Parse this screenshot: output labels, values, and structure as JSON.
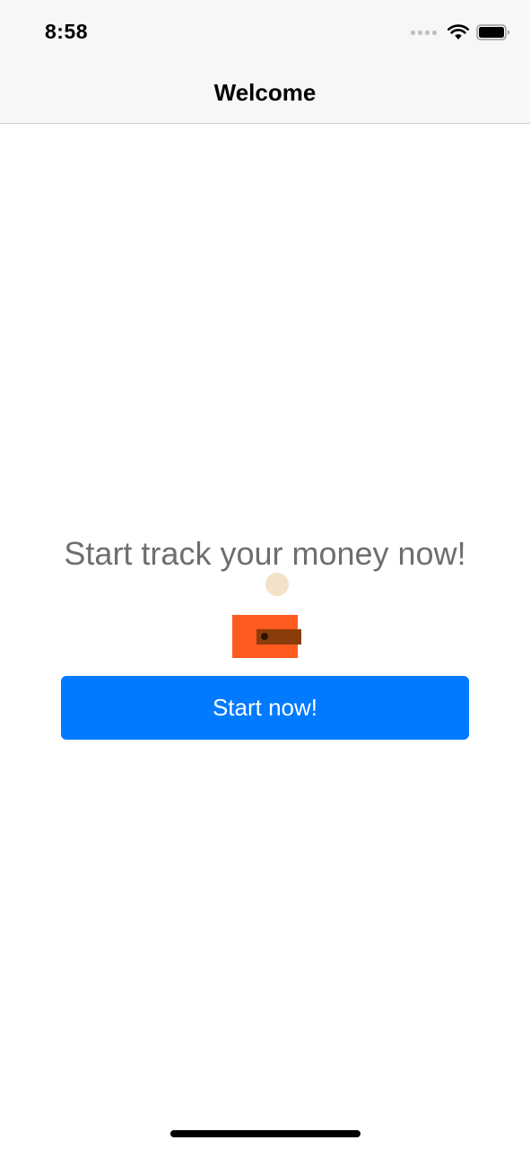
{
  "status_bar": {
    "time": "8:58",
    "icons": [
      "signal-dots-icon",
      "wifi-icon",
      "battery-icon"
    ]
  },
  "nav": {
    "title": "Welcome"
  },
  "main": {
    "headline": "Start track your money now!",
    "illustration": "wallet-icon",
    "start_button_label": "Start now!"
  },
  "colors": {
    "accent": "#007aff",
    "headline_text": "#6e6e6e",
    "bar_background": "#f7f7f7",
    "wallet_body": "#ff5a1f",
    "wallet_strap": "#8a3d0b",
    "coin": "#f2e2c7"
  }
}
